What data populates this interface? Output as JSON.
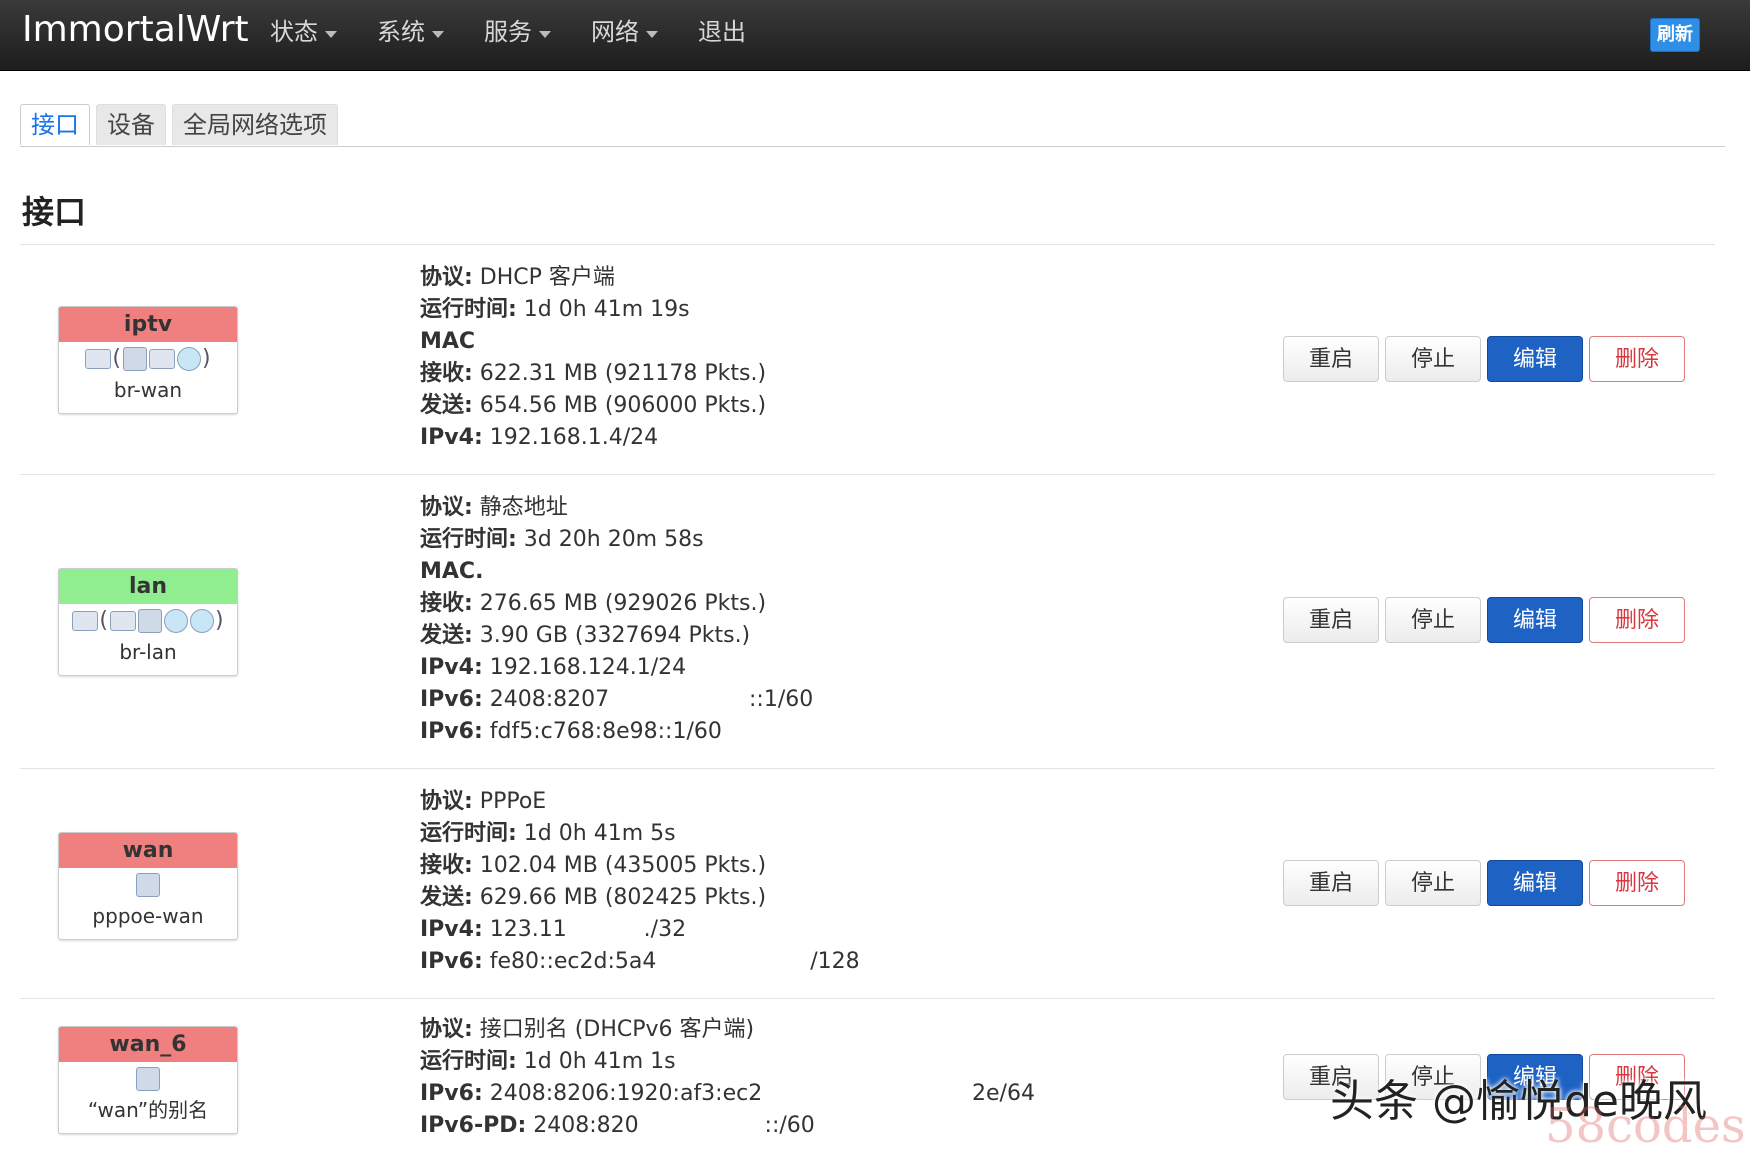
{
  "topbar": {
    "brand": "ImmortalWrt",
    "menu": [
      "状态",
      "系统",
      "服务",
      "网络",
      "退出"
    ],
    "refresh": "刷新"
  },
  "tabs": [
    "接口",
    "设备",
    "全局网络选项"
  ],
  "section_title": "接口",
  "buttons": {
    "restart": "重启",
    "stop": "停止",
    "edit": "编辑",
    "delete": "删除"
  },
  "interfaces": [
    {
      "name": "iptv",
      "color": "#f08080",
      "device": "br-wan",
      "lines": [
        {
          "k": "协议:",
          "v": " DHCP 客户端"
        },
        {
          "k": "运行时间:",
          "v": " 1d 0h 41m 19s"
        },
        {
          "k": "MAC",
          "v": ""
        },
        {
          "k": "接收:",
          "v": " 622.31 MB (921178 Pkts.)"
        },
        {
          "k": "发送:",
          "v": " 654.56 MB (906000 Pkts.)"
        },
        {
          "k": "IPv4:",
          "v": " 192.168.1.4/24"
        }
      ]
    },
    {
      "name": "lan",
      "color": "#90ee90",
      "device": "br-lan",
      "lines": [
        {
          "k": "协议:",
          "v": " 静态地址"
        },
        {
          "k": "运行时间:",
          "v": " 3d 20h 20m 58s"
        },
        {
          "k": "MAC.",
          "v": ""
        },
        {
          "k": "接收:",
          "v": " 276.65 MB (929026 Pkts.)"
        },
        {
          "k": "发送:",
          "v": " 3.90 GB (3327694 Pkts.)"
        },
        {
          "k": "IPv4:",
          "v": " 192.168.124.1/24"
        },
        {
          "k": "IPv6:",
          "v": " 2408:8207                    ::1/60"
        },
        {
          "k": "IPv6:",
          "v": " fdf5:c768:8e98::1/60"
        }
      ]
    },
    {
      "name": "wan",
      "color": "#f08080",
      "device": "pppoe-wan",
      "lines": [
        {
          "k": "协议:",
          "v": " PPPoE"
        },
        {
          "k": "运行时间:",
          "v": " 1d 0h 41m 5s"
        },
        {
          "k": "接收:",
          "v": " 102.04 MB (435005 Pkts.)"
        },
        {
          "k": "发送:",
          "v": " 629.66 MB (802425 Pkts.)"
        },
        {
          "k": "IPv4:",
          "v": " 123.11           ./32"
        },
        {
          "k": "IPv6:",
          "v": " fe80::ec2d:5a4                      /128"
        }
      ]
    },
    {
      "name": "wan_6",
      "color": "#f08080",
      "device": "“wan”的别名",
      "lines": [
        {
          "k": "协议:",
          "v": " 接口别名 (DHCPv6 客户端)"
        },
        {
          "k": "运行时间:",
          "v": " 1d 0h 41m 1s"
        },
        {
          "k": "IPv6:",
          "v": " 2408:8206:1920:af3:ec2                              2e/64"
        },
        {
          "k": "IPv6-PD:",
          "v": " 2408:820                  ::/60"
        }
      ]
    }
  ],
  "watermark": "头条 @愉悦de晚风",
  "watermark_site": "58codes"
}
